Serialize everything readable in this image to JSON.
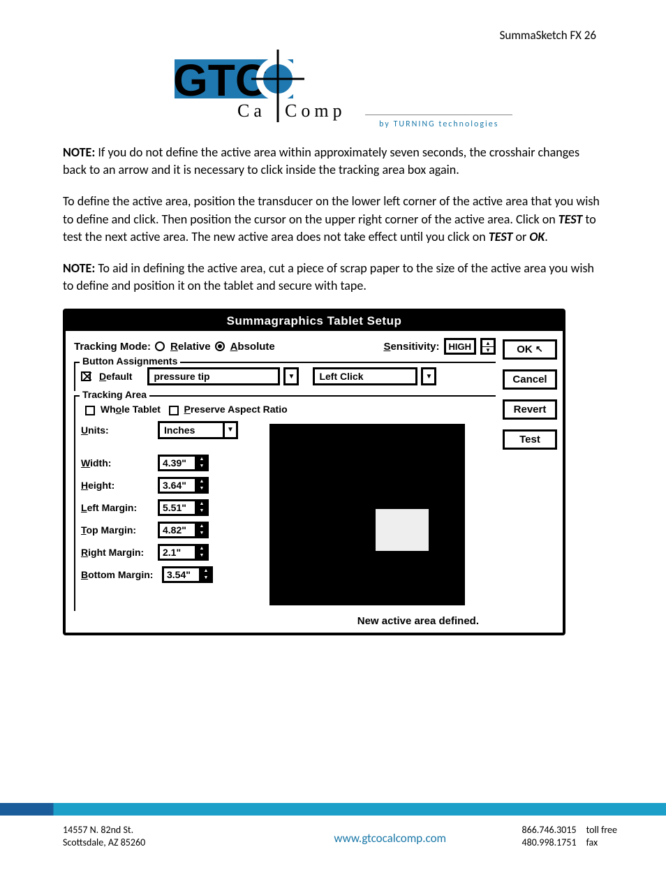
{
  "header": {
    "page_title": "SummaSketch FX 26"
  },
  "logo": {
    "sub": "by TURNING technologies",
    "brand1": "Ca",
    "brand2": "Comp"
  },
  "para1": {
    "note": "NOTE:",
    "text": " If you do not define the active area within approximately seven seconds, the crosshair changes back to an arrow and it is necessary to click inside the tracking area box again."
  },
  "para2": {
    "t1": "To define the active area, position the transducer on the lower left corner of the active area that you wish to define and click.  Then position the cursor on the upper right corner of the active area.  Click on ",
    "test": "TEST",
    "t2": " to test the next active area.  The new active area does not take effect until you click on ",
    "test2": "TEST",
    "or": " or ",
    "ok": "OK",
    "t3": "."
  },
  "para3": {
    "note": "NOTE:",
    "text": " To aid in defining the active area, cut a piece of scrap paper to the size of the active area you wish to define and position it on the tablet and secure with tape."
  },
  "dialog": {
    "title": "Summagraphics Tablet Setup",
    "tracking_mode_label": "Tracking Mode:",
    "relative": "Relative",
    "absolute": "Absolute",
    "sensitivity_label": "Sensitivity:",
    "sensitivity_value": "HIGH",
    "btn_ok": "OK",
    "btn_cancel": "Cancel",
    "btn_revert": "Revert",
    "btn_test": "Test",
    "group_buttons": "Button Assignments",
    "default_label": "Default",
    "combo1": "pressure tip",
    "combo2": "Left Click",
    "group_tracking": "Tracking Area",
    "whole_tablet": "Whole Tablet",
    "preserve": "Preserve Aspect Ratio",
    "units_label": "Units:",
    "units_value": "Inches",
    "width_label": "Width:",
    "width_val": "4.39\"",
    "height_label": "Height:",
    "height_val": "3.64\"",
    "left_label": "Left Margin:",
    "left_val": "5.51\"",
    "top_label": "Top Margin:",
    "top_val": "4.82\"",
    "right_label": "Right Margin:",
    "right_val": "2.1\"",
    "bottom_label": "Bottom Margin:",
    "bottom_val": "3.54\"",
    "status": "New active area defined."
  },
  "footer": {
    "addr1": "14557 N. 82nd St.",
    "addr2": "Scottsdale, AZ 85260",
    "url": "www.gtcocalcomp.com",
    "phone1": "866.746.3015",
    "phone2": "480.998.1751",
    "lbl1": "toll free",
    "lbl2": "fax"
  }
}
